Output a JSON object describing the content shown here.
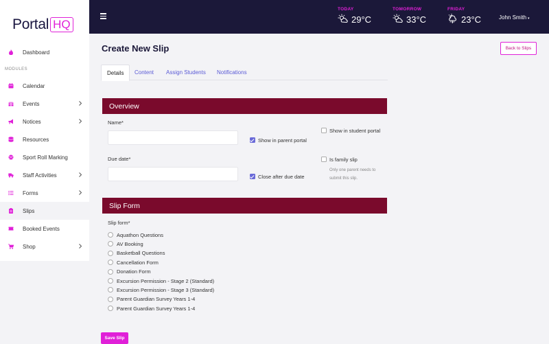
{
  "logo": {
    "text": "Portal",
    "badge": "HQ"
  },
  "sidebar": {
    "modules_label": "MODULES",
    "items": [
      {
        "label": "Dashboard",
        "icon": "fire-icon"
      },
      {
        "label": "Calendar",
        "icon": "calendar-icon"
      },
      {
        "label": "Events",
        "icon": "gift-icon",
        "has_submenu": true
      },
      {
        "label": "Notices",
        "icon": "megaphone-icon",
        "has_submenu": true
      },
      {
        "label": "Resources",
        "icon": "database-icon"
      },
      {
        "label": "Sport Roll Marking",
        "icon": "ball-icon"
      },
      {
        "label": "Staff Activities",
        "icon": "truck-icon",
        "has_submenu": true
      },
      {
        "label": "Forms",
        "icon": "list-icon",
        "has_submenu": true
      },
      {
        "label": "Slips",
        "icon": "clipboard-icon",
        "active": true
      },
      {
        "label": "Booked Events",
        "icon": "ticket-icon"
      },
      {
        "label": "Shop",
        "icon": "cart-icon",
        "has_submenu": true
      }
    ]
  },
  "topbar": {
    "weather": [
      {
        "day": "TODAY",
        "temp": "29°C",
        "icon": "partly-sunny-icon"
      },
      {
        "day": "TOMORROW",
        "temp": "33°C",
        "icon": "partly-sunny-icon"
      },
      {
        "day": "FRIDAY",
        "temp": "23°C",
        "icon": "thunderstorm-icon"
      }
    ],
    "user_name": "John Smith",
    "user_caret": "▾"
  },
  "header": {
    "title": "Create New Slip",
    "back_button": "Back to Slips"
  },
  "tabs": [
    {
      "label": "Details",
      "active": true
    },
    {
      "label": "Content"
    },
    {
      "label": "Assign Students"
    },
    {
      "label": "Notifications"
    }
  ],
  "overview": {
    "heading": "Overview",
    "name_label": "Name*",
    "name_value": "",
    "show_parent_portal": {
      "label": "Show in parent portal",
      "checked": true
    },
    "show_student_portal": {
      "label": "Show in student portal",
      "checked": false
    },
    "due_date_label": "Due date*",
    "due_date_value": "",
    "close_after_due": {
      "label": "Close after due date",
      "checked": true
    },
    "is_family_slip": {
      "label": "Is family slip",
      "checked": false,
      "hint": "Only one parent needs to submit this slip."
    }
  },
  "slip_form": {
    "heading": "Slip Form",
    "label": "Slip form*",
    "options": [
      "Aquathon Questions",
      "AV Booking",
      "Basketball Questions",
      "Cancellation Form",
      "Donation Form",
      "Excursion Permission - Stage 2 (Standard)",
      "Excursion Permission - Stage 3 (Standard)",
      "Parent Guardian Survey Years 1-4",
      "Parent Guardian Survey Years 1-4"
    ]
  },
  "save_button": "Save Slip",
  "colors": {
    "accent": "#e020d8",
    "topbar": "#1b1839",
    "section_header": "#7a0a2c",
    "checkbox": "#6a6ad8",
    "link": "#5a5ad6"
  }
}
